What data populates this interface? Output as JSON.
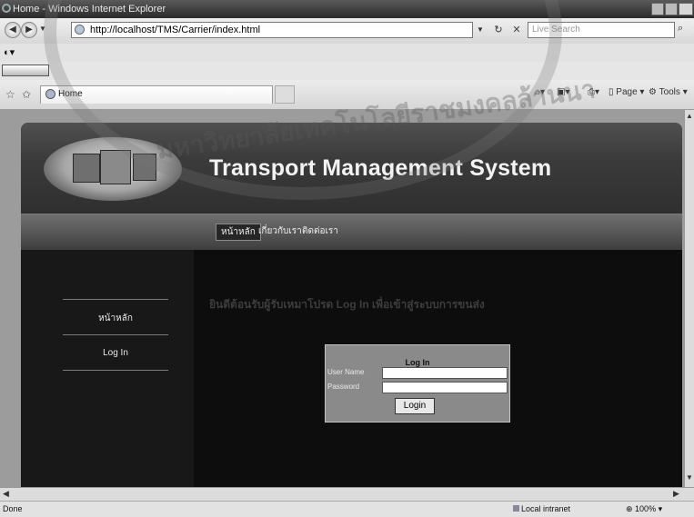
{
  "window": {
    "title": "Home - Windows Internet Explorer"
  },
  "address_bar": {
    "url": "http://localhost/TMS/Carrier/index.html",
    "search_placeholder": "Live Search"
  },
  "tab": {
    "label": "Home"
  },
  "command_bar": {
    "page_label": "Page",
    "tools_label": "Tools"
  },
  "site": {
    "title": "Transport Management System",
    "nav": [
      "หน้าหลัก",
      "เกี่ยวกับเรา",
      "ติดต่อเรา"
    ],
    "sidebar": [
      "หน้าหลัก",
      "Log In"
    ],
    "welcome_text": "ยินดีต้อนรับผู้รับเหมาโปรด Log In เพื่อเข้าสู่ระบบการขนส่ง",
    "login": {
      "title": "Log In",
      "username_label": "User Name",
      "password_label": "Password",
      "button_label": "Login"
    }
  },
  "status_bar": {
    "status": "Done",
    "zone": "Local intranet",
    "zoom": "100%"
  },
  "watermark": {
    "text": "มหาวิทยาลัยเทคโนโลยีราชมงคลล้านนา"
  }
}
